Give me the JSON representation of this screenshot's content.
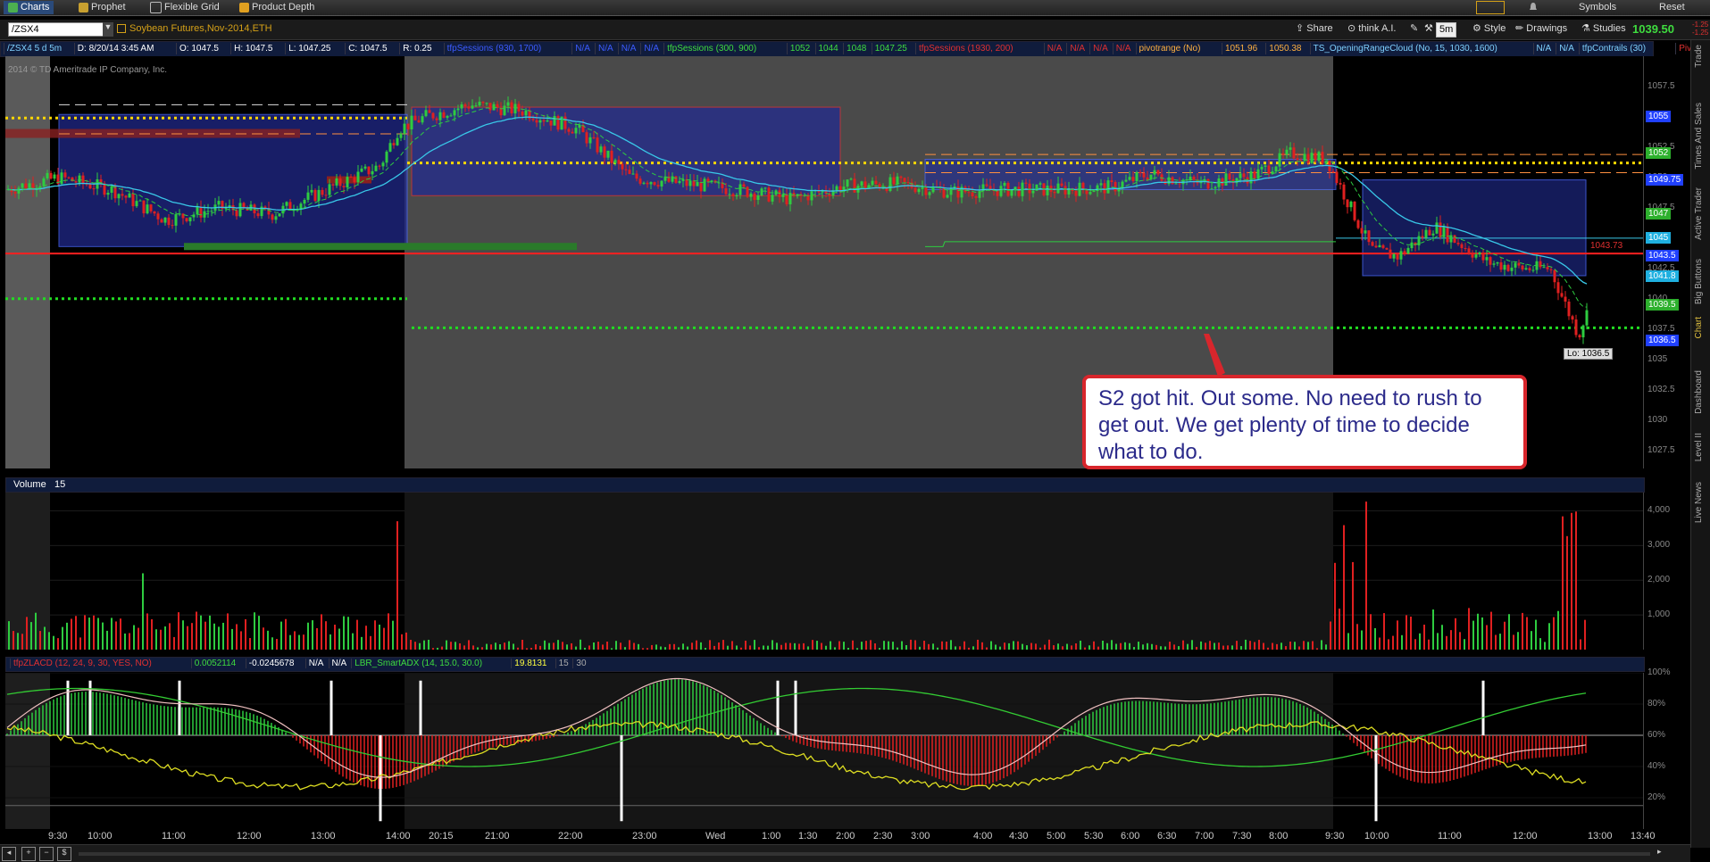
{
  "menubar": {
    "items": [
      {
        "label": "Charts",
        "active": true,
        "icon": "chart-icon"
      },
      {
        "label": "Prophet",
        "icon": "prophet-icon"
      },
      {
        "label": "Flexible Grid",
        "icon": "grid-icon"
      },
      {
        "label": "Product Depth",
        "icon": "depth-icon"
      }
    ],
    "right_items": [
      "Symbols",
      "Reset"
    ]
  },
  "toolbar": {
    "symbol": "/ZSX4",
    "description": "Soybean Futures,Nov-2014,ETH",
    "share": "Share",
    "think": "think A.I.",
    "timeframe": "5m",
    "style": "Style",
    "drawings": "Drawings",
    "studies": "Studies",
    "last_price": "1039.50",
    "change_top": "-1.25",
    "change_bottom": "-1.25"
  },
  "studies_row": {
    "chips": [
      {
        "text": "/ZSX4 5 d 5m",
        "color": "#7fd1ff"
      },
      {
        "text": "D: 8/20/14 3:45 AM",
        "color": "#fff"
      },
      {
        "text": "O: 1047.5",
        "color": "#fff"
      },
      {
        "text": "H: 1047.5",
        "color": "#fff"
      },
      {
        "text": "L: 1047.25",
        "color": "#fff"
      },
      {
        "text": "C: 1047.5",
        "color": "#fff"
      },
      {
        "text": "R: 0.25",
        "color": "#fff"
      },
      {
        "text": "tfpSessions (930, 1700)",
        "color": "#3b5bff"
      },
      {
        "text": "N/A",
        "color": "#3b5bff"
      },
      {
        "text": "N/A",
        "color": "#3b5bff"
      },
      {
        "text": "N/A",
        "color": "#3b5bff"
      },
      {
        "text": "N/A",
        "color": "#3b5bff"
      },
      {
        "text": "tfpSessions (300, 900)",
        "color": "#3fdc3f"
      },
      {
        "text": "1052",
        "color": "#3fdc3f"
      },
      {
        "text": "1044",
        "color": "#3fdc3f"
      },
      {
        "text": "1048",
        "color": "#3fdc3f"
      },
      {
        "text": "1047.25",
        "color": "#3fdc3f"
      },
      {
        "text": "tfpSessions (1930, 200)",
        "color": "#e03030"
      },
      {
        "text": "N/A",
        "color": "#e03030"
      },
      {
        "text": "N/A",
        "color": "#e03030"
      },
      {
        "text": "N/A",
        "color": "#e03030"
      },
      {
        "text": "N/A",
        "color": "#e03030"
      },
      {
        "text": "pivotrange (No)",
        "color": "#ffb040"
      },
      {
        "text": "1051.96",
        "color": "#ffb040"
      },
      {
        "text": "1050.38",
        "color": "#ffb040"
      },
      {
        "text": "TS_OpeningRangeCloud (No, 15, 1030, 1600)",
        "color": "#7fd1ff"
      },
      {
        "text": "N/A",
        "color": "#7fd1ff"
      },
      {
        "text": "N/A",
        "color": "#7fd1ff"
      },
      {
        "text": "tfpContrails (30)",
        "color": "#7fd1ff"
      },
      {
        "text": "PivotPoints (No, ...",
        "color": "#e03030"
      }
    ]
  },
  "copyright": "2014 © TD Ameritrade IP Company, Inc.",
  "price_axis": [
    "1057.5",
    "1055",
    "1052.5",
    "1050",
    "1047.5",
    "1045",
    "1042.5",
    "1040",
    "1037.5",
    "1035",
    "1032.5",
    "1030",
    "1027.5"
  ],
  "price_tags": [
    {
      "text": "1055",
      "bg": "#2040ff"
    },
    {
      "text": "1052",
      "bg": "#2db02d"
    },
    {
      "text": "1049.75",
      "bg": "#2040ff"
    },
    {
      "text": "1047",
      "bg": "#2db02d"
    },
    {
      "text": "1045",
      "bg": "#1fb0e0"
    },
    {
      "text": "1043.5",
      "bg": "#2040ff"
    },
    {
      "text": "1041.8",
      "bg": "#1fb0e0"
    },
    {
      "text": "1039.5",
      "bg": "#2db02d"
    },
    {
      "text": "1036.5",
      "bg": "#2040ff"
    }
  ],
  "red_line_label": "1043.73",
  "lo_label": "Lo: 1036.5",
  "volume": {
    "header_label": "Volume",
    "header_value": "15",
    "axis": [
      "4,000",
      "3,000",
      "2,000",
      "1,000"
    ]
  },
  "lower_study": {
    "chips": [
      {
        "text": "tfpZLACD (12, 24, 9, 30, YES, NO)",
        "color": "#e03030"
      },
      {
        "text": "0.0052114",
        "color": "#3fdc3f"
      },
      {
        "text": "-0.0245678",
        "color": "#fff"
      },
      {
        "text": "N/A",
        "color": "#fff"
      },
      {
        "text": "N/A",
        "color": "#fff"
      },
      {
        "text": "LBR_SmartADX (14, 15.0, 30.0)",
        "color": "#3fdc3f"
      },
      {
        "text": "19.8131",
        "color": "#ffff40"
      },
      {
        "text": "15",
        "color": "#aaa"
      },
      {
        "text": "30",
        "color": "#aaa"
      }
    ],
    "axis": [
      "100%",
      "80%",
      "60%",
      "40%",
      "20%"
    ]
  },
  "time_axis": [
    "9:30",
    "10:00",
    "11:00",
    "12:00",
    "13:00",
    "14:00",
    "20:15",
    "21:00",
    "22:00",
    "23:00",
    "Wed",
    "1:00",
    "1:30",
    "2:00",
    "2:30",
    "3:00",
    "4:00",
    "4:30",
    "5:00",
    "5:30",
    "6:00",
    "6:30",
    "7:00",
    "7:30",
    "8:00",
    "9:30",
    "10:00",
    "11:00",
    "12:00",
    "13:00",
    "13:40"
  ],
  "callout_text": "S2 got hit. Out some. No need to rush to get out. We get plenty of time to decide what to do.",
  "sidebar_tabs": [
    "Trade",
    "Times And Sales",
    "Active Trader",
    "Big Buttons",
    "Chart",
    "Dashboard",
    "Level II",
    "Live News"
  ],
  "colors": {
    "up": "#2ecc40",
    "down": "#e02020",
    "ema1": "#39c8e8",
    "ema2": "#2ecc40",
    "pivot": "#ffd700",
    "s2": "#22dd22",
    "red_level": "#ff2020"
  }
}
